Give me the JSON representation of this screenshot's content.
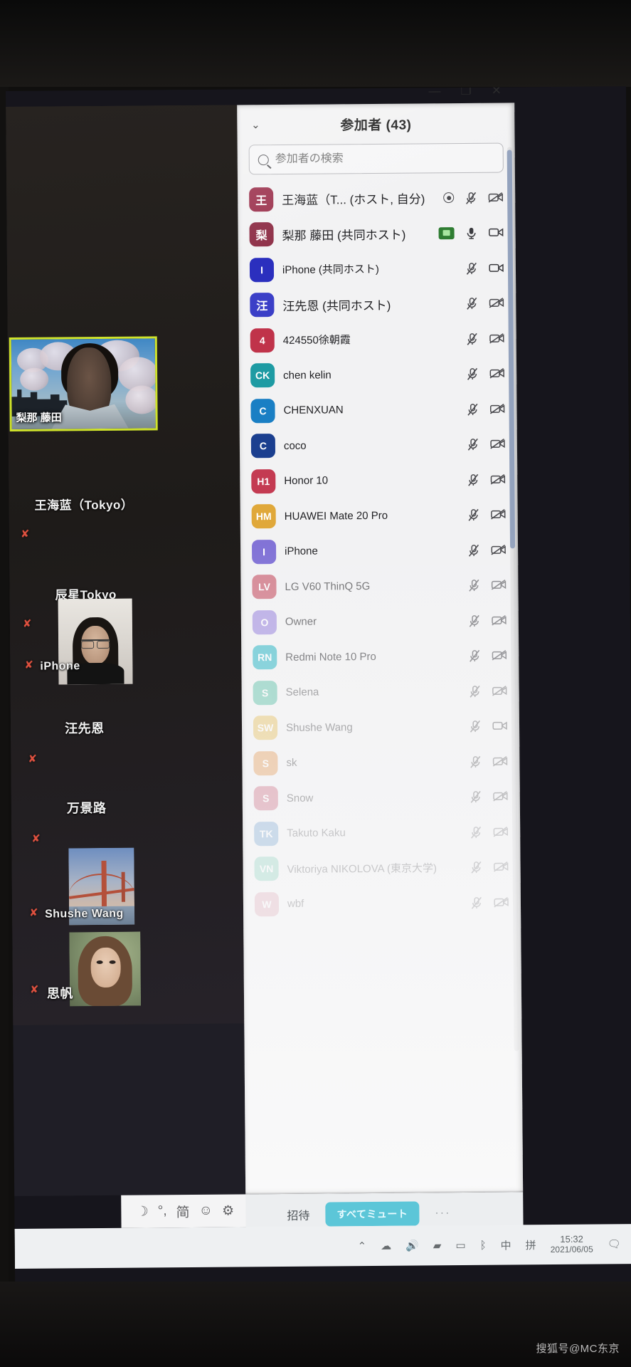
{
  "window": {
    "minimize": "—",
    "restore": "❐",
    "close": "✕"
  },
  "panel": {
    "collapse_icon": "chevron-down",
    "title": "参加者 (43)",
    "search_placeholder": "参加者の検索",
    "search_value": "",
    "footer": {
      "invite_label": "招待",
      "mute_all_label": "すべてミュート",
      "more_label": "···"
    }
  },
  "participants": [
    {
      "initials": "王",
      "color": "#9d3550",
      "name": "王海蓝（T... (ホスト, 自分)",
      "cjk": true,
      "mic": "muted",
      "video": "off",
      "record": true
    },
    {
      "initials": "梨",
      "color": "#8e2f47",
      "name": "梨那 藤田 (共同ホスト)",
      "cjk": true,
      "mic": "on",
      "video": "on",
      "share": true
    },
    {
      "initials": "I",
      "color": "#2b2fbe",
      "name": "iPhone (共同ホスト)",
      "cjk": false,
      "mic": "muted",
      "video": "on"
    },
    {
      "initials": "汪",
      "color": "#3b3fc7",
      "name": "汪先恩 (共同ホスト)",
      "cjk": true,
      "mic": "muted",
      "video": "off"
    },
    {
      "initials": "4",
      "color": "#c0334a",
      "name": "424550徐朝霞",
      "cjk": false,
      "mic": "muted",
      "video": "off"
    },
    {
      "initials": "CK",
      "color": "#1e9ba3",
      "name": "chen kelin",
      "cjk": false,
      "mic": "muted",
      "video": "off"
    },
    {
      "initials": "C",
      "color": "#1a7fc4",
      "name": "CHENXUAN",
      "cjk": false,
      "mic": "muted",
      "video": "off"
    },
    {
      "initials": "C",
      "color": "#1b3f8f",
      "name": "coco",
      "cjk": false,
      "mic": "muted",
      "video": "off"
    },
    {
      "initials": "H1",
      "color": "#c43b52",
      "name": "Honor 10",
      "cjk": false,
      "mic": "muted",
      "video": "off"
    },
    {
      "initials": "HM",
      "color": "#e0a83a",
      "name": "HUAWEI Mate 20 Pro",
      "cjk": false,
      "mic": "muted",
      "video": "off"
    },
    {
      "initials": "I",
      "color": "#8071d6",
      "name": "iPhone",
      "cjk": false,
      "mic": "muted",
      "video": "off"
    },
    {
      "initials": "LV",
      "color": "#c4495c",
      "name": "LG V60 ThinQ 5G",
      "cjk": false,
      "mic": "muted",
      "video": "off"
    },
    {
      "initials": "O",
      "color": "#9a85dd",
      "name": "Owner",
      "cjk": false,
      "mic": "muted",
      "video": "off"
    },
    {
      "initials": "RN",
      "color": "#29b5c4",
      "name": "Redmi Note 10 Pro",
      "cjk": false,
      "mic": "muted",
      "video": "off"
    },
    {
      "initials": "S",
      "color": "#35b394",
      "name": "Selena",
      "cjk": false,
      "mic": "muted",
      "video": "off"
    },
    {
      "initials": "SW",
      "color": "#e3b43e",
      "name": "Shushe Wang",
      "cjk": false,
      "mic": "muted",
      "video": "on"
    },
    {
      "initials": "S",
      "color": "#e0893a",
      "name": "sk",
      "cjk": false,
      "mic": "muted",
      "video": "off"
    },
    {
      "initials": "S",
      "color": "#c4566f",
      "name": "Snow",
      "cjk": false,
      "mic": "muted",
      "video": "off"
    },
    {
      "initials": "TK",
      "color": "#3b7fbd",
      "name": "Takuto Kaku",
      "cjk": false,
      "mic": "muted",
      "video": "off"
    },
    {
      "initials": "VN",
      "color": "#58c0a0",
      "name": "Viktoriya NIKOLOVA (東京大学)",
      "cjk": false,
      "mic": "muted",
      "video": "off"
    },
    {
      "initials": "W",
      "color": "#d2889a",
      "name": "wbf",
      "cjk": false,
      "mic": "muted",
      "video": "off"
    }
  ],
  "gallery": {
    "active_speaker": {
      "label": "梨那 藤田"
    },
    "tiles": [
      {
        "label": "王海蓝（Tokyo）",
        "muted": true
      },
      {
        "label": "辰星Tokyo",
        "muted": true
      },
      {
        "label": "iPhone",
        "muted": true
      },
      {
        "label": "汪先恩",
        "muted": true
      },
      {
        "label": "万景路",
        "muted": true
      },
      {
        "label": "Shushe Wang",
        "muted": true
      },
      {
        "label": "思帆",
        "muted": true
      }
    ]
  },
  "meeting_toolbar": {
    "icons": [
      "moon-icon",
      "degree-icon",
      "ime-kanji-icon",
      "emoji-icon",
      "gear-icon"
    ],
    "ime_label": "简"
  },
  "taskbar": {
    "icons": [
      "chevron-up-icon",
      "onedrive-icon",
      "volume-icon",
      "wifi-icon",
      "battery-icon",
      "bluetooth-icon"
    ],
    "ime_lang": "中",
    "ime_mode": "拼",
    "time": "15:32",
    "date": "2021/06/05",
    "notification_icon": "notification-icon"
  },
  "watermark": "搜狐号@MC东京"
}
